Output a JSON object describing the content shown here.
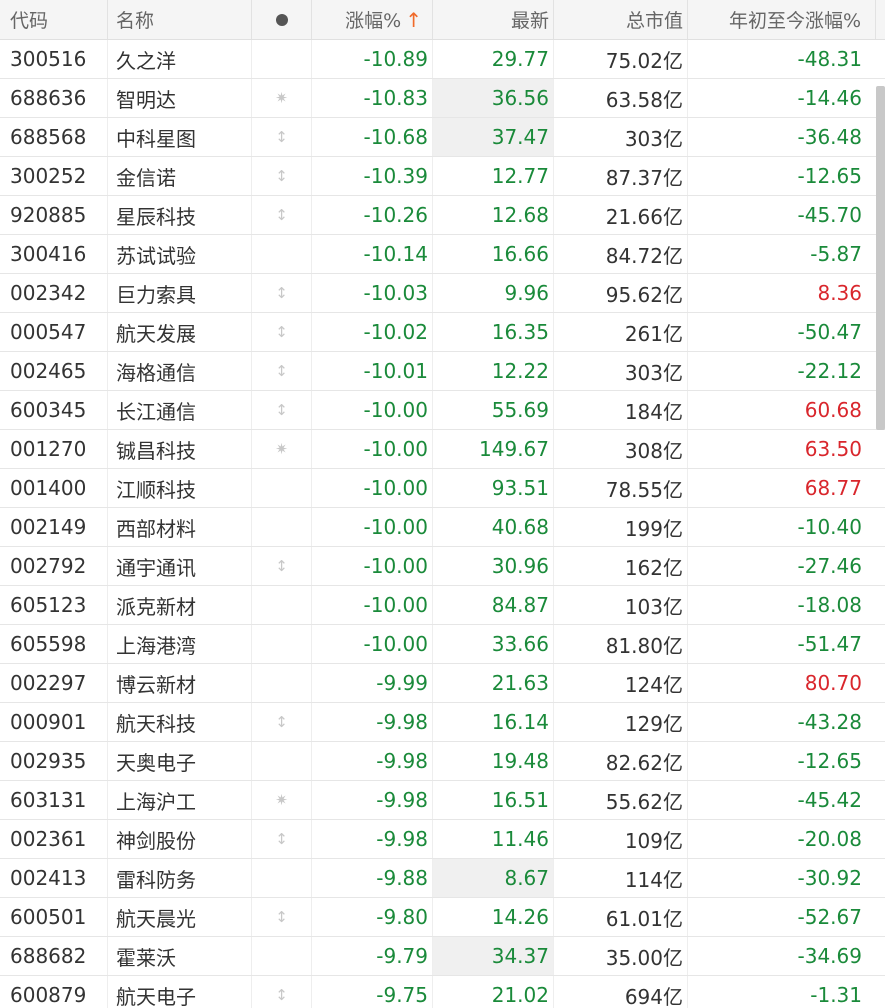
{
  "header": {
    "code": "代码",
    "name": "名称",
    "mark": "●",
    "change_pct": "涨幅%",
    "sort_arrow": "↑",
    "last": "最新",
    "market_cap": "总市值",
    "ytd_pct": "年初至今涨幅%"
  },
  "colors": {
    "down": "#1a8a3a",
    "up": "#d9262c",
    "sort_arrow": "#f06a2a"
  },
  "rows": [
    {
      "code": "300516",
      "name": "久之洋",
      "mark": "",
      "change_pct": "-10.89",
      "last": "29.77",
      "market_cap": "75.02亿",
      "ytd_pct": "-48.31",
      "ytd_dir": "down",
      "last_highlight": false
    },
    {
      "code": "688636",
      "name": "智明达",
      "mark": "✷",
      "change_pct": "-10.83",
      "last": "36.56",
      "market_cap": "63.58亿",
      "ytd_pct": "-14.46",
      "ytd_dir": "down",
      "last_highlight": true
    },
    {
      "code": "688568",
      "name": "中科星图",
      "mark": "↕",
      "change_pct": "-10.68",
      "last": "37.47",
      "market_cap": "303亿",
      "ytd_pct": "-36.48",
      "ytd_dir": "down",
      "last_highlight": true
    },
    {
      "code": "300252",
      "name": "金信诺",
      "mark": "↕",
      "change_pct": "-10.39",
      "last": "12.77",
      "market_cap": "87.37亿",
      "ytd_pct": "-12.65",
      "ytd_dir": "down",
      "last_highlight": false
    },
    {
      "code": "920885",
      "name": "星辰科技",
      "mark": "↕",
      "change_pct": "-10.26",
      "last": "12.68",
      "market_cap": "21.66亿",
      "ytd_pct": "-45.70",
      "ytd_dir": "down",
      "last_highlight": false
    },
    {
      "code": "300416",
      "name": "苏试试验",
      "mark": "",
      "change_pct": "-10.14",
      "last": "16.66",
      "market_cap": "84.72亿",
      "ytd_pct": "-5.87",
      "ytd_dir": "down",
      "last_highlight": false
    },
    {
      "code": "002342",
      "name": "巨力索具",
      "mark": "↕",
      "change_pct": "-10.03",
      "last": "9.96",
      "market_cap": "95.62亿",
      "ytd_pct": "8.36",
      "ytd_dir": "up",
      "last_highlight": false
    },
    {
      "code": "000547",
      "name": "航天发展",
      "mark": "↕",
      "change_pct": "-10.02",
      "last": "16.35",
      "market_cap": "261亿",
      "ytd_pct": "-50.47",
      "ytd_dir": "down",
      "last_highlight": false
    },
    {
      "code": "002465",
      "name": "海格通信",
      "mark": "↕",
      "change_pct": "-10.01",
      "last": "12.22",
      "market_cap": "303亿",
      "ytd_pct": "-22.12",
      "ytd_dir": "down",
      "last_highlight": false
    },
    {
      "code": "600345",
      "name": "长江通信",
      "mark": "↕",
      "change_pct": "-10.00",
      "last": "55.69",
      "market_cap": "184亿",
      "ytd_pct": "60.68",
      "ytd_dir": "up",
      "last_highlight": false
    },
    {
      "code": "001270",
      "name": "铖昌科技",
      "mark": "✷",
      "change_pct": "-10.00",
      "last": "149.67",
      "market_cap": "308亿",
      "ytd_pct": "63.50",
      "ytd_dir": "up",
      "last_highlight": false
    },
    {
      "code": "001400",
      "name": "江顺科技",
      "mark": "",
      "change_pct": "-10.00",
      "last": "93.51",
      "market_cap": "78.55亿",
      "ytd_pct": "68.77",
      "ytd_dir": "up",
      "last_highlight": false
    },
    {
      "code": "002149",
      "name": "西部材料",
      "mark": "",
      "change_pct": "-10.00",
      "last": "40.68",
      "market_cap": "199亿",
      "ytd_pct": "-10.40",
      "ytd_dir": "down",
      "last_highlight": false
    },
    {
      "code": "002792",
      "name": "通宇通讯",
      "mark": "↕",
      "change_pct": "-10.00",
      "last": "30.96",
      "market_cap": "162亿",
      "ytd_pct": "-27.46",
      "ytd_dir": "down",
      "last_highlight": false
    },
    {
      "code": "605123",
      "name": "派克新材",
      "mark": "",
      "change_pct": "-10.00",
      "last": "84.87",
      "market_cap": "103亿",
      "ytd_pct": "-18.08",
      "ytd_dir": "down",
      "last_highlight": false
    },
    {
      "code": "605598",
      "name": "上海港湾",
      "mark": "",
      "change_pct": "-10.00",
      "last": "33.66",
      "market_cap": "81.80亿",
      "ytd_pct": "-51.47",
      "ytd_dir": "down",
      "last_highlight": false
    },
    {
      "code": "002297",
      "name": "博云新材",
      "mark": "",
      "change_pct": "-9.99",
      "last": "21.63",
      "market_cap": "124亿",
      "ytd_pct": "80.70",
      "ytd_dir": "up",
      "last_highlight": false
    },
    {
      "code": "000901",
      "name": "航天科技",
      "mark": "↕",
      "change_pct": "-9.98",
      "last": "16.14",
      "market_cap": "129亿",
      "ytd_pct": "-43.28",
      "ytd_dir": "down",
      "last_highlight": false
    },
    {
      "code": "002935",
      "name": "天奥电子",
      "mark": "",
      "change_pct": "-9.98",
      "last": "19.48",
      "market_cap": "82.62亿",
      "ytd_pct": "-12.65",
      "ytd_dir": "down",
      "last_highlight": false
    },
    {
      "code": "603131",
      "name": "上海沪工",
      "mark": "✷",
      "change_pct": "-9.98",
      "last": "16.51",
      "market_cap": "55.62亿",
      "ytd_pct": "-45.42",
      "ytd_dir": "down",
      "last_highlight": false
    },
    {
      "code": "002361",
      "name": "神剑股份",
      "mark": "↕",
      "change_pct": "-9.98",
      "last": "11.46",
      "market_cap": "109亿",
      "ytd_pct": "-20.08",
      "ytd_dir": "down",
      "last_highlight": false
    },
    {
      "code": "002413",
      "name": "雷科防务",
      "mark": "",
      "change_pct": "-9.88",
      "last": "8.67",
      "market_cap": "114亿",
      "ytd_pct": "-30.92",
      "ytd_dir": "down",
      "last_highlight": true
    },
    {
      "code": "600501",
      "name": "航天晨光",
      "mark": "↕",
      "change_pct": "-9.80",
      "last": "14.26",
      "market_cap": "61.01亿",
      "ytd_pct": "-52.67",
      "ytd_dir": "down",
      "last_highlight": false
    },
    {
      "code": "688682",
      "name": "霍莱沃",
      "mark": "",
      "change_pct": "-9.79",
      "last": "34.37",
      "market_cap": "35.00亿",
      "ytd_pct": "-34.69",
      "ytd_dir": "down",
      "last_highlight": true
    },
    {
      "code": "600879",
      "name": "航天电子",
      "mark": "↕",
      "change_pct": "-9.75",
      "last": "21.02",
      "market_cap": "694亿",
      "ytd_pct": "-1.31",
      "ytd_dir": "down",
      "last_highlight": false
    }
  ]
}
